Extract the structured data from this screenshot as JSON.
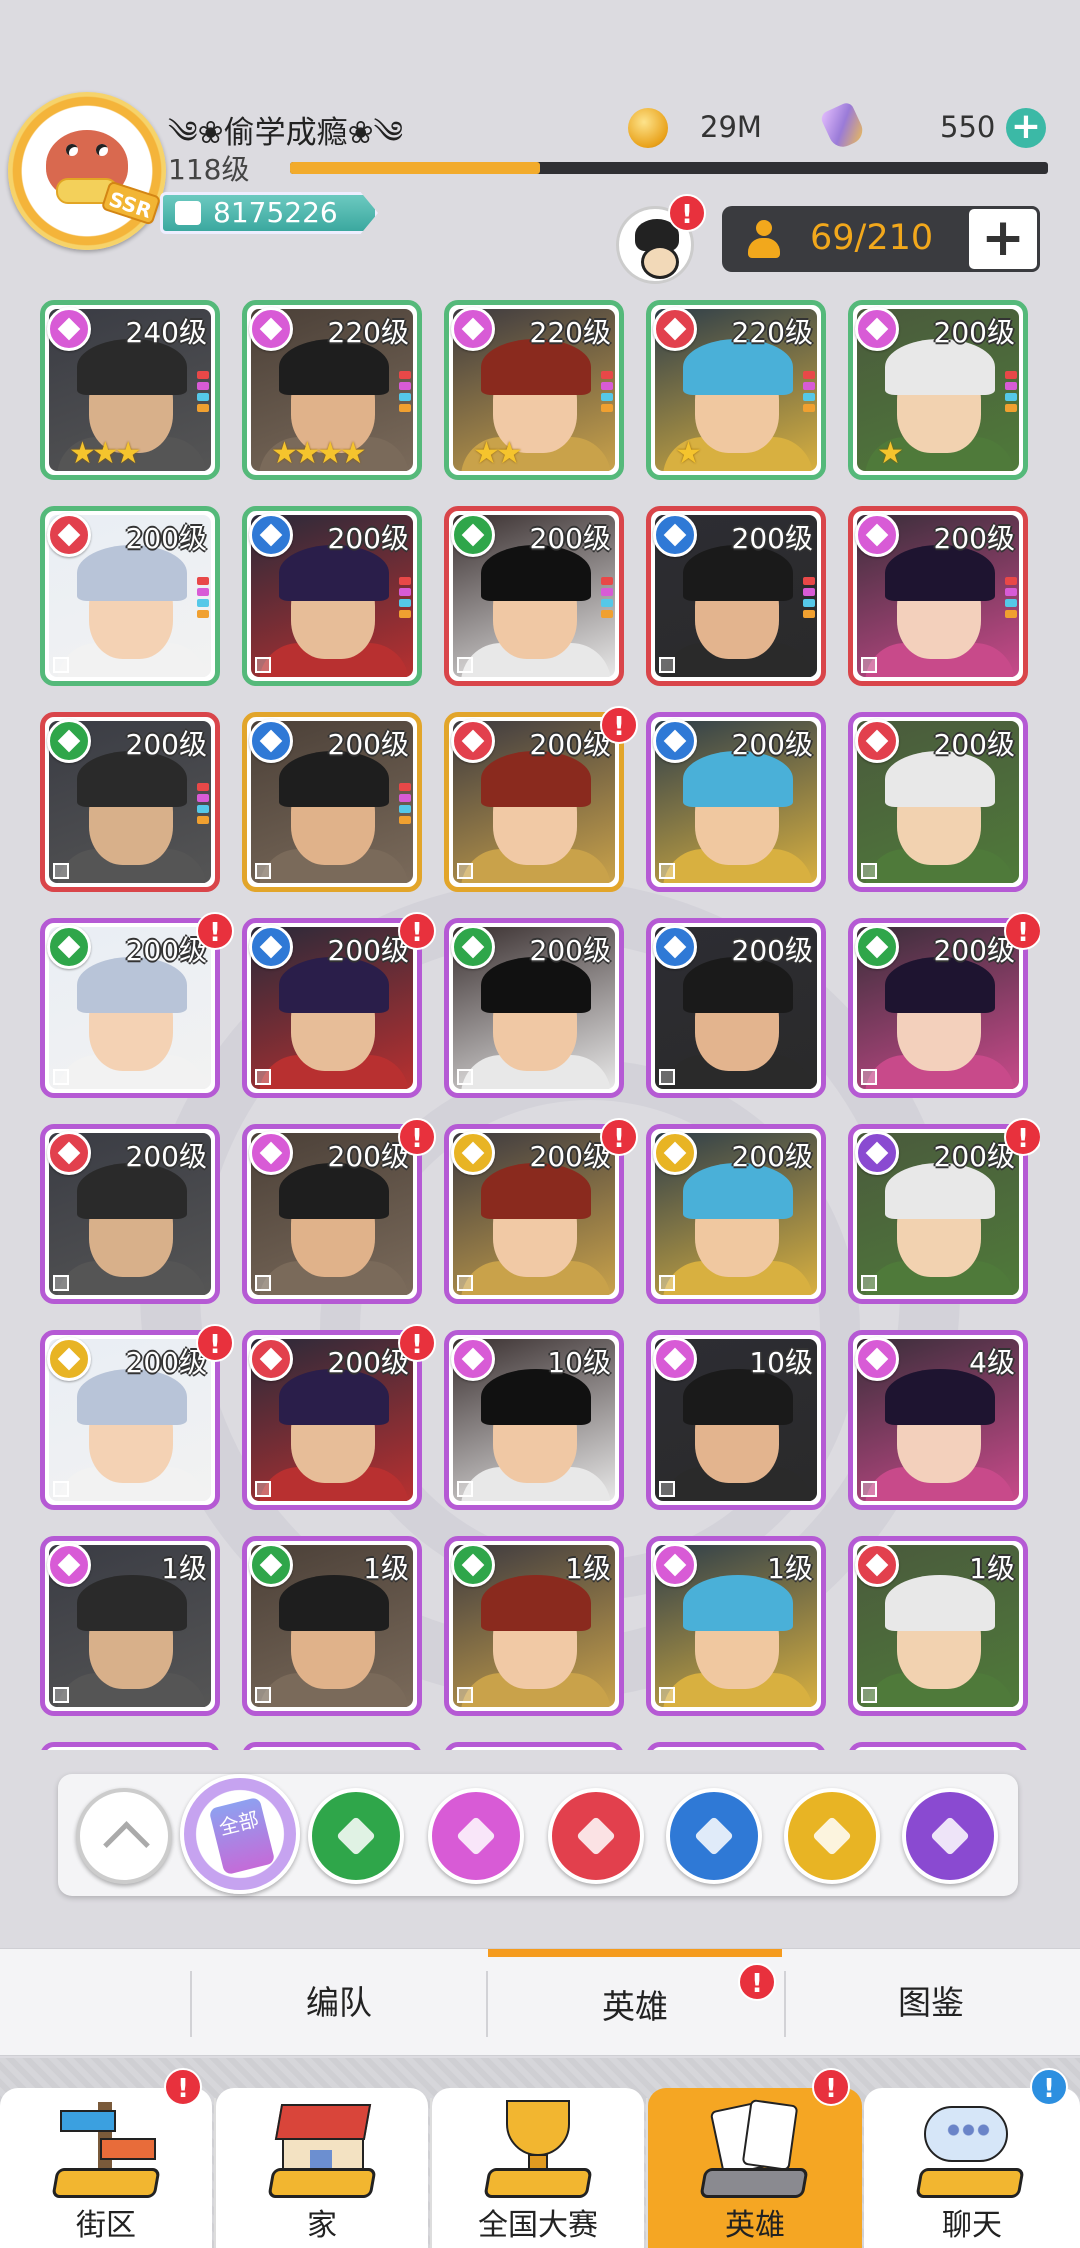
{
  "player": {
    "badge": "SSR",
    "name": "༄❀偷学成瘾❀༄",
    "level": "118级",
    "xp_fraction": 0.33,
    "power": "8175226"
  },
  "resources": {
    "coins": "29M",
    "gems": "550"
  },
  "hero_count": "69/210",
  "heroes": [
    {
      "level": "240级",
      "faction": "heart",
      "frame": "green",
      "stars": "★★★",
      "alert": false
    },
    {
      "level": "220级",
      "faction": "heart",
      "frame": "green",
      "stars": "★★★★",
      "alert": false
    },
    {
      "level": "220级",
      "faction": "heart",
      "frame": "green",
      "stars": "★★",
      "alert": false
    },
    {
      "level": "220级",
      "faction": "club",
      "frame": "green",
      "stars": "★",
      "alert": false
    },
    {
      "level": "200级",
      "faction": "heart",
      "frame": "green",
      "stars": "★",
      "alert": false
    },
    {
      "level": "200级",
      "faction": "club",
      "frame": "green",
      "stars": "",
      "alert": false
    },
    {
      "level": "200级",
      "faction": "diamond",
      "frame": "green",
      "stars": "",
      "alert": false
    },
    {
      "level": "200级",
      "faction": "spade",
      "frame": "red",
      "stars": "",
      "alert": false
    },
    {
      "level": "200级",
      "faction": "diamond",
      "frame": "red",
      "stars": "",
      "alert": false
    },
    {
      "level": "200级",
      "faction": "heart",
      "frame": "red",
      "stars": "",
      "alert": false
    },
    {
      "level": "200级",
      "faction": "spade",
      "frame": "red",
      "stars": "",
      "alert": false
    },
    {
      "level": "200级",
      "faction": "diamond",
      "frame": "gold",
      "stars": "",
      "alert": false
    },
    {
      "level": "200级",
      "faction": "club",
      "frame": "gold",
      "stars": "",
      "alert": true
    },
    {
      "level": "200级",
      "faction": "diamond",
      "frame": "purple",
      "stars": "",
      "alert": false
    },
    {
      "level": "200级",
      "faction": "club",
      "frame": "purple",
      "stars": "",
      "alert": false
    },
    {
      "level": "200级",
      "faction": "spade",
      "frame": "purple",
      "stars": "",
      "alert": true
    },
    {
      "level": "200级",
      "faction": "diamond",
      "frame": "purple",
      "stars": "",
      "alert": true
    },
    {
      "level": "200级",
      "faction": "spade",
      "frame": "purple",
      "stars": "",
      "alert": false
    },
    {
      "level": "200级",
      "faction": "diamond",
      "frame": "purple",
      "stars": "",
      "alert": false
    },
    {
      "level": "200级",
      "faction": "spade",
      "frame": "purple",
      "stars": "",
      "alert": true
    },
    {
      "level": "200级",
      "faction": "club",
      "frame": "purple",
      "stars": "",
      "alert": false
    },
    {
      "level": "200级",
      "faction": "heart",
      "frame": "purple",
      "stars": "",
      "alert": true
    },
    {
      "level": "200级",
      "faction": "sun",
      "frame": "purple",
      "stars": "",
      "alert": true
    },
    {
      "level": "200级",
      "faction": "sun",
      "frame": "purple",
      "stars": "",
      "alert": false
    },
    {
      "level": "200级",
      "faction": "moon",
      "frame": "purple",
      "stars": "",
      "alert": true
    },
    {
      "level": "200级",
      "faction": "sun",
      "frame": "purple",
      "stars": "",
      "alert": true
    },
    {
      "level": "200级",
      "faction": "club",
      "frame": "purple",
      "stars": "",
      "alert": true
    },
    {
      "level": "10级",
      "faction": "heart",
      "frame": "purple",
      "stars": "",
      "alert": false
    },
    {
      "level": "10级",
      "faction": "heart",
      "frame": "purple",
      "stars": "",
      "alert": false
    },
    {
      "level": "4级",
      "faction": "heart",
      "frame": "purple",
      "stars": "",
      "alert": false
    },
    {
      "level": "1级",
      "faction": "heart",
      "frame": "purple",
      "stars": "",
      "alert": false
    },
    {
      "level": "1级",
      "faction": "spade",
      "frame": "purple",
      "stars": "",
      "alert": false
    },
    {
      "level": "1级",
      "faction": "spade",
      "frame": "purple",
      "stars": "",
      "alert": false
    },
    {
      "level": "1级",
      "faction": "heart",
      "frame": "purple",
      "stars": "",
      "alert": false
    },
    {
      "level": "1级",
      "faction": "club",
      "frame": "purple",
      "stars": "",
      "alert": false
    }
  ],
  "filters": {
    "all_label": "全部",
    "factions": [
      "spade-icon",
      "heart-icon",
      "club-icon",
      "diamond-icon",
      "sun-icon",
      "moon-icon"
    ]
  },
  "subtabs": [
    {
      "label": "编队",
      "active": false,
      "alert": false
    },
    {
      "label": "英雄",
      "active": true,
      "alert": true
    },
    {
      "label": "图鉴",
      "active": false,
      "alert": false
    }
  ],
  "bottom_nav": [
    {
      "label": "街区",
      "icon": "signpost-icon",
      "active": false,
      "alert": "red"
    },
    {
      "label": "家",
      "icon": "house-icon",
      "active": false,
      "alert": ""
    },
    {
      "label": "全国大赛",
      "icon": "trophy-icon",
      "active": false,
      "alert": ""
    },
    {
      "label": "英雄",
      "icon": "hero-cards-icon",
      "active": true,
      "alert": "red"
    },
    {
      "label": "聊天",
      "icon": "chat-bubble-icon",
      "active": false,
      "alert": "blue"
    }
  ],
  "colors": {
    "accent": "#f5a623",
    "frame_green": "#55b97a",
    "frame_red": "#d9454a",
    "frame_gold": "#e2a52a",
    "frame_purple": "#b55ad4"
  }
}
